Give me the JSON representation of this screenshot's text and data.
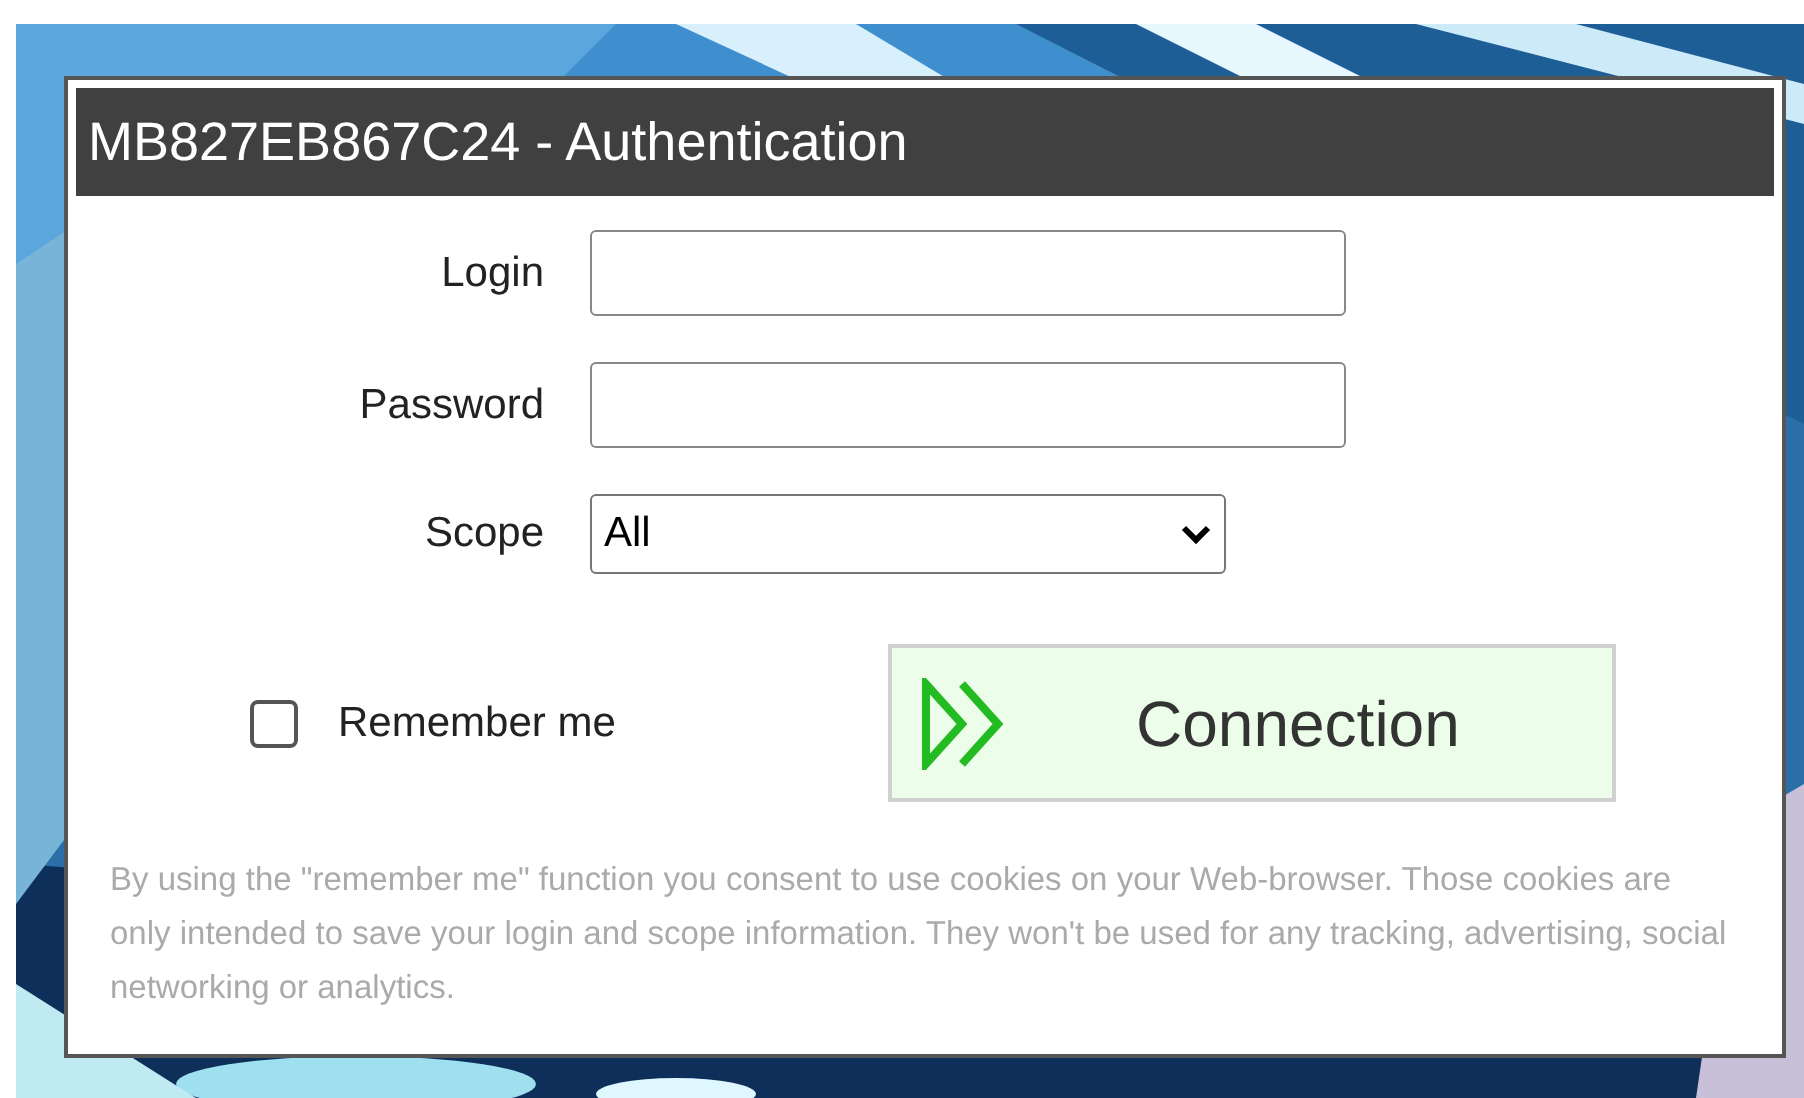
{
  "dialog": {
    "title": "MB827EB867C24 - Authentication"
  },
  "fields": [
    {
      "kind": "text",
      "label": "Login"
    },
    {
      "kind": "password",
      "label": "Password"
    },
    {
      "kind": "select",
      "label": "Scope",
      "value": "All"
    }
  ],
  "remember": {
    "label": "Remember me",
    "checked": false
  },
  "connect_button": {
    "label": "Connection"
  },
  "notice": "By using the \"remember me\" function you consent to use cookies on your Web-browser. Those cookies are only intended to save your login and scope information. They won't be used for any tracking, advertising, social networking or analytics."
}
